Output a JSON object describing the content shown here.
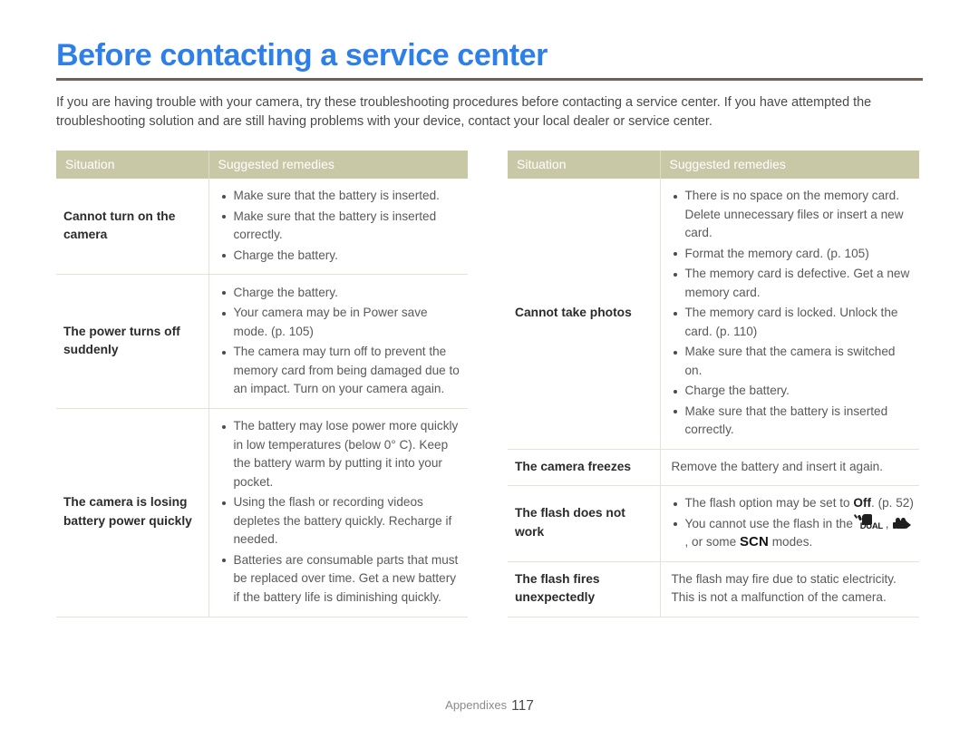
{
  "page": {
    "title": "Before contacting a service center",
    "intro": "If you are having trouble with your camera, try these troubleshooting procedures before contacting a service center. If you have attempted the troubleshooting solution and are still having problems with your device, contact your local dealer or service center.",
    "accent_color": "#2f7fe8",
    "rule_color": "#6b6159",
    "table_header_bg": "#c9c8a6",
    "table_border_color": "#e7e2d4"
  },
  "footer": {
    "section": "Appendixes",
    "page_number": "117"
  },
  "left_table": {
    "headers": {
      "situation": "Situation",
      "remedies": "Suggested remedies"
    },
    "rows": [
      {
        "situation": "Cannot turn on the camera",
        "remedies": [
          "Make sure that the battery is inserted.",
          "Make sure that the battery is inserted correctly.",
          "Charge the battery."
        ]
      },
      {
        "situation": "The power turns off suddenly",
        "remedies": [
          "Charge the battery.",
          "Your camera may be in Power save mode. (p. 105)",
          "The camera may turn off to prevent the memory card from being damaged due to an impact. Turn on your camera again."
        ]
      },
      {
        "situation": "The camera is losing battery power quickly",
        "remedies": [
          "The battery may lose power more quickly in low temperatures (below 0° C). Keep the battery warm by putting it into your pocket.",
          "Using the flash or recording videos depletes the battery quickly. Recharge if needed.",
          "Batteries are consumable parts that must be replaced over time. Get a new battery if the battery life is diminishing quickly."
        ]
      }
    ]
  },
  "right_table": {
    "headers": {
      "situation": "Situation",
      "remedies": "Suggested remedies"
    },
    "rows": [
      {
        "situation": "Cannot take photos",
        "remedies": [
          "There is no space on the memory card. Delete unnecessary files or insert a new card.",
          "Format the memory card. (p. 105)",
          "The memory card is defective. Get a new memory card.",
          "The memory card is locked. Unlock the card. (p. 110)",
          "Make sure that the camera is switched on.",
          "Charge the battery.",
          "Make sure that the battery is inserted correctly."
        ]
      },
      {
        "situation": "The camera freezes",
        "remedies_plain": "Remove the battery and insert it again."
      },
      {
        "situation": "The flash does not work",
        "remedies_rich": {
          "item1_before": "The flash option may be set to ",
          "item1_bold": "Off",
          "item1_after": ". (p. 52)",
          "item2_before": "You cannot use the flash in the ",
          "item2_icon1": "dual-mode-icon",
          "item2_icon1_label": "DUAL",
          "item2_mid": ", ",
          "item2_icon2": "movie-mode-icon",
          "item2_mid2": ", or some ",
          "item2_scn": "SCN",
          "item2_after": " modes."
        }
      },
      {
        "situation": "The flash fires unexpectedly",
        "remedies_plain_lines": [
          "The flash may fire due to static electricity.",
          "This is not a malfunction of the camera."
        ]
      }
    ]
  }
}
